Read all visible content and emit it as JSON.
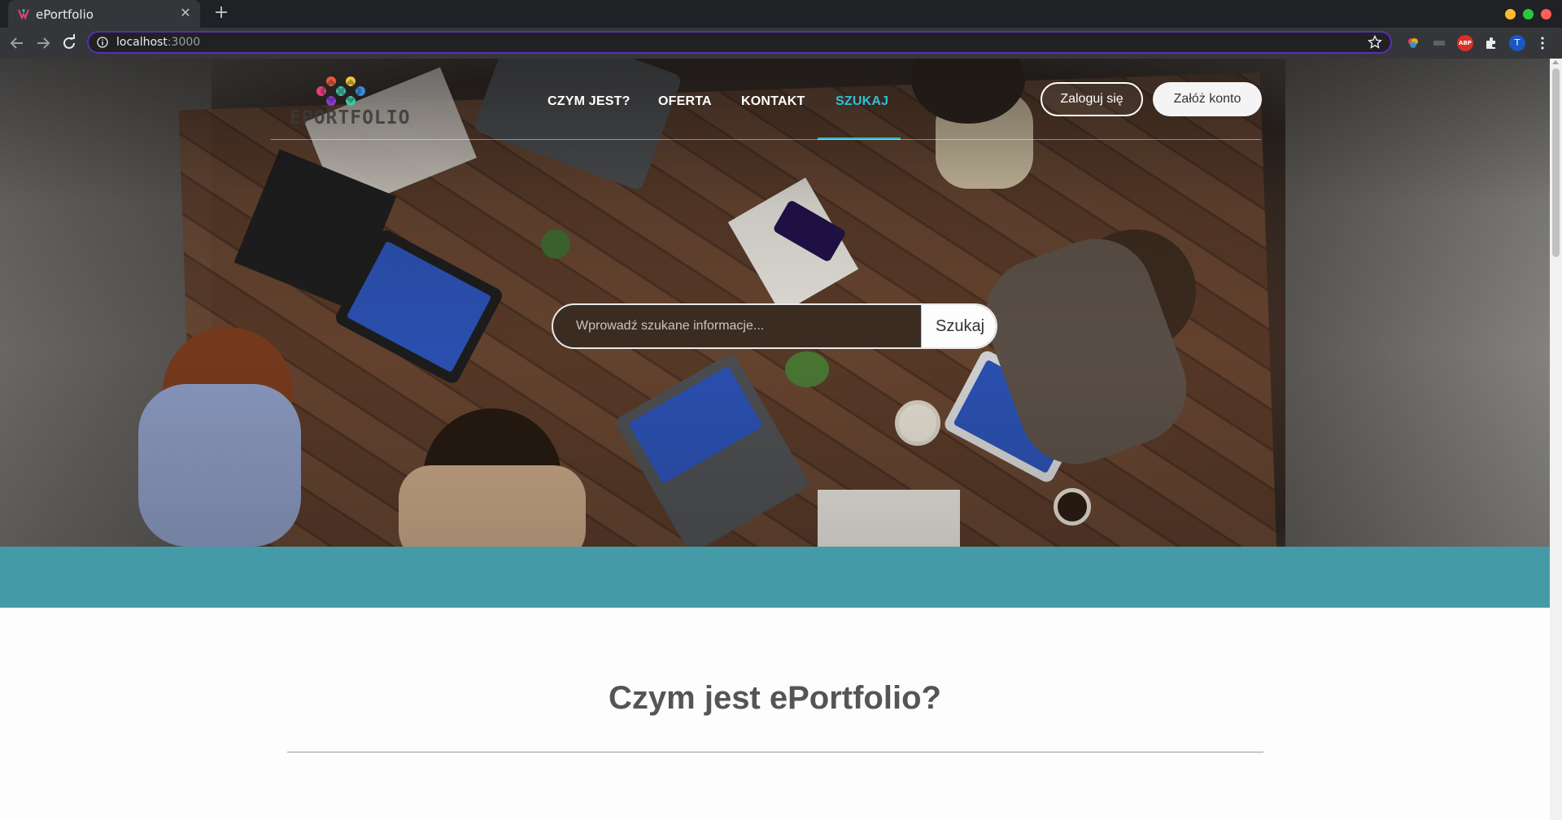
{
  "browser": {
    "tab_title": "ePortfolio",
    "tab_close": "✕",
    "new_tab": "+",
    "url_host": "localhost",
    "url_port": ":3000",
    "profile_initial": "T",
    "abp_label": "ABP",
    "colors": {
      "close": "#ff5f57",
      "minimize": "#febc2e",
      "maximize": "#28c840",
      "accent": "#5a2fb0"
    }
  },
  "header": {
    "logo_text": "EPORTFOLIO",
    "nav": [
      {
        "label": "CZYM JEST?",
        "active": false
      },
      {
        "label": "OFERTA",
        "active": false
      },
      {
        "label": "KONTAKT",
        "active": false
      },
      {
        "label": "SZUKAJ",
        "active": true
      }
    ],
    "login_label": "Zaloguj się",
    "signup_label": "Załóż konto",
    "accent_color": "#33b6c9"
  },
  "search": {
    "placeholder": "Wprowadź szukane informacje...",
    "button_label": "Szukaj"
  },
  "band_color": "#449ba7",
  "section": {
    "title": "Czym jest ePortfolio?"
  }
}
